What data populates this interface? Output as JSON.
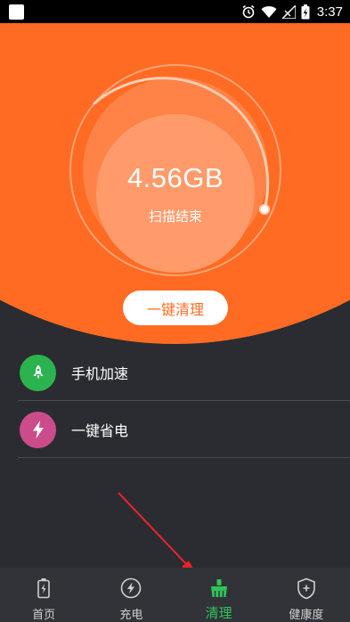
{
  "status_bar": {
    "time": "3:37"
  },
  "scan": {
    "size": "4.56GB",
    "status": "扫描结束",
    "clean_button": "一键清理"
  },
  "features": [
    {
      "label": "手机加速",
      "icon": "rocket-icon",
      "color": "#2cb34f"
    },
    {
      "label": "一键省电",
      "icon": "lightning-icon",
      "color": "#cc4c8b"
    }
  ],
  "nav": {
    "items": [
      {
        "label": "首页",
        "icon": "battery-icon"
      },
      {
        "label": "充电",
        "icon": "charge-icon"
      },
      {
        "label": "清理",
        "icon": "broom-icon",
        "active": true
      },
      {
        "label": "健康度",
        "icon": "shield-icon"
      }
    ]
  },
  "colors": {
    "accent": "#ff6b23",
    "background": "#2b2c31",
    "active_tab": "#2ec45a"
  }
}
